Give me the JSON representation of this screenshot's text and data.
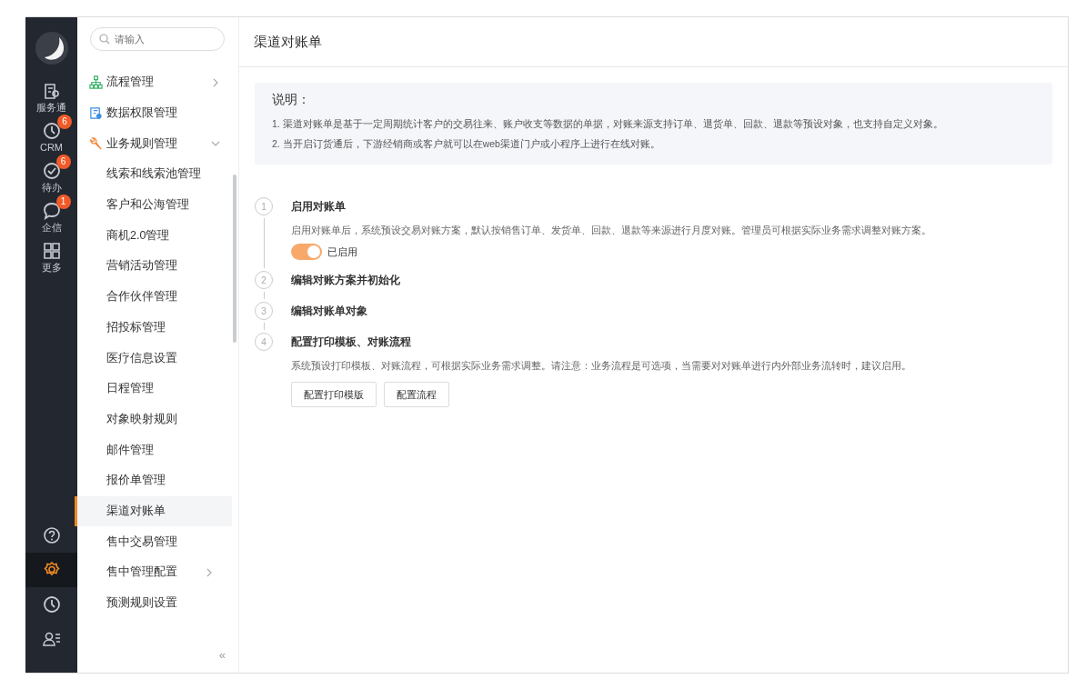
{
  "rail": {
    "top": [
      {
        "label": "服务通",
        "kind": "service"
      },
      {
        "label": "CRM",
        "kind": "clock",
        "badge": "6"
      },
      {
        "label": "待办",
        "kind": "check",
        "badge": "6"
      },
      {
        "label": "企信",
        "kind": "chat",
        "badge": "1"
      },
      {
        "label": "更多",
        "kind": "grid"
      }
    ],
    "bottom": [
      {
        "kind": "help",
        "selected": false
      },
      {
        "kind": "gear",
        "selected": true
      },
      {
        "kind": "clock",
        "selected": false
      },
      {
        "kind": "contacts",
        "selected": false
      }
    ]
  },
  "menu": {
    "search": {
      "placeholder": "请输入"
    },
    "items": [
      {
        "label": "流程管理",
        "kind": "flow",
        "expanded": false
      },
      {
        "label": "数据权限管理",
        "kind": "data"
      },
      {
        "label": "业务规则管理",
        "kind": "wrench",
        "expanded": true,
        "children": [
          {
            "label": "线索和线索池管理",
            "selected": false
          },
          {
            "label": "客户和公海管理",
            "selected": false
          },
          {
            "label": "商机2.0管理",
            "selected": false
          },
          {
            "label": "营销活动管理",
            "selected": false
          },
          {
            "label": "合作伙伴管理",
            "selected": false
          },
          {
            "label": "招投标管理",
            "selected": false
          },
          {
            "label": "医疗信息设置",
            "selected": false
          },
          {
            "label": "日程管理",
            "selected": false
          },
          {
            "label": "对象映射规则",
            "selected": false
          },
          {
            "label": "邮件管理",
            "selected": false
          },
          {
            "label": "报价单管理",
            "selected": false
          },
          {
            "label": "渠道对账单",
            "selected": true
          },
          {
            "label": "售中交易管理",
            "selected": false
          },
          {
            "label": "售中管理配置",
            "selected": false,
            "expanded": false
          },
          {
            "label": "预测规则设置",
            "selected": false
          }
        ]
      }
    ],
    "collapse": "«"
  },
  "page": {
    "title": "渠道对账单",
    "notice": {
      "heading": "说明：",
      "lines": [
        "1. 渠道对账单是基于一定周期统计客户的交易往来、账户收支等数据的单据，对账来源支持订单、退货单、回款、退款等预设对象，也支持自定义对象。",
        "2. 当开启订货通后，下游经销商或客户就可以在web渠道门户或小程序上进行在线对账。"
      ]
    },
    "steps": [
      {
        "number": "1",
        "title": "启用对账单",
        "description": "启用对账单后，系统预设交易对账方案，默认按销售订单、发货单、回款、退款等来源进行月度对账。管理员可根据实际业务需求调整对账方案。",
        "toggle": {
          "on": true,
          "label": "已启用"
        }
      },
      {
        "number": "2",
        "title": "编辑对账方案并初始化"
      },
      {
        "number": "3",
        "title": "编辑对账单对象"
      },
      {
        "number": "4",
        "title": "配置打印模板、对账流程",
        "description": "系统预设打印模板、对账流程，可根据实际业务需求调整。请注意：业务流程是可选项，当需要对对账单进行内外部业务流转时，建议启用。",
        "buttons": [
          "配置打印模版",
          "配置流程"
        ]
      }
    ]
  }
}
